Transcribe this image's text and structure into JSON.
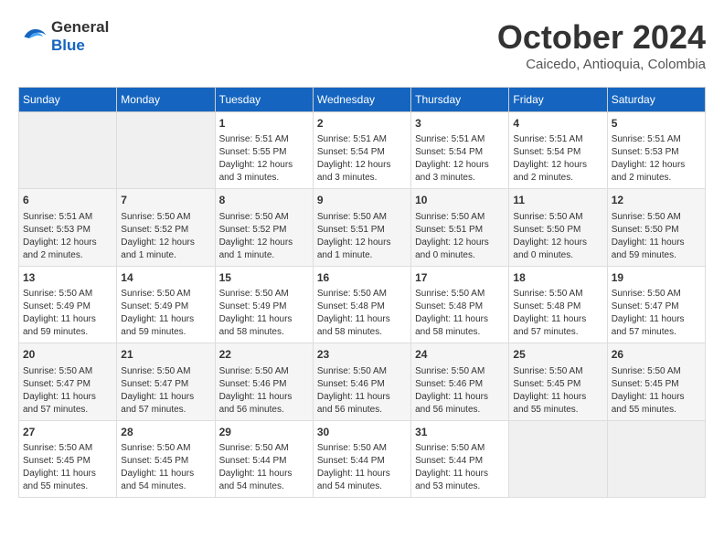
{
  "logo": {
    "line1": "General",
    "line2": "Blue"
  },
  "title": "October 2024",
  "subtitle": "Caicedo, Antioquia, Colombia",
  "weekdays": [
    "Sunday",
    "Monday",
    "Tuesday",
    "Wednesday",
    "Thursday",
    "Friday",
    "Saturday"
  ],
  "weeks": [
    [
      {
        "day": "",
        "info": ""
      },
      {
        "day": "",
        "info": ""
      },
      {
        "day": "1",
        "info": "Sunrise: 5:51 AM\nSunset: 5:55 PM\nDaylight: 12 hours\nand 3 minutes."
      },
      {
        "day": "2",
        "info": "Sunrise: 5:51 AM\nSunset: 5:54 PM\nDaylight: 12 hours\nand 3 minutes."
      },
      {
        "day": "3",
        "info": "Sunrise: 5:51 AM\nSunset: 5:54 PM\nDaylight: 12 hours\nand 3 minutes."
      },
      {
        "day": "4",
        "info": "Sunrise: 5:51 AM\nSunset: 5:54 PM\nDaylight: 12 hours\nand 2 minutes."
      },
      {
        "day": "5",
        "info": "Sunrise: 5:51 AM\nSunset: 5:53 PM\nDaylight: 12 hours\nand 2 minutes."
      }
    ],
    [
      {
        "day": "6",
        "info": "Sunrise: 5:51 AM\nSunset: 5:53 PM\nDaylight: 12 hours\nand 2 minutes."
      },
      {
        "day": "7",
        "info": "Sunrise: 5:50 AM\nSunset: 5:52 PM\nDaylight: 12 hours\nand 1 minute."
      },
      {
        "day": "8",
        "info": "Sunrise: 5:50 AM\nSunset: 5:52 PM\nDaylight: 12 hours\nand 1 minute."
      },
      {
        "day": "9",
        "info": "Sunrise: 5:50 AM\nSunset: 5:51 PM\nDaylight: 12 hours\nand 1 minute."
      },
      {
        "day": "10",
        "info": "Sunrise: 5:50 AM\nSunset: 5:51 PM\nDaylight: 12 hours\nand 0 minutes."
      },
      {
        "day": "11",
        "info": "Sunrise: 5:50 AM\nSunset: 5:50 PM\nDaylight: 12 hours\nand 0 minutes."
      },
      {
        "day": "12",
        "info": "Sunrise: 5:50 AM\nSunset: 5:50 PM\nDaylight: 11 hours\nand 59 minutes."
      }
    ],
    [
      {
        "day": "13",
        "info": "Sunrise: 5:50 AM\nSunset: 5:49 PM\nDaylight: 11 hours\nand 59 minutes."
      },
      {
        "day": "14",
        "info": "Sunrise: 5:50 AM\nSunset: 5:49 PM\nDaylight: 11 hours\nand 59 minutes."
      },
      {
        "day": "15",
        "info": "Sunrise: 5:50 AM\nSunset: 5:49 PM\nDaylight: 11 hours\nand 58 minutes."
      },
      {
        "day": "16",
        "info": "Sunrise: 5:50 AM\nSunset: 5:48 PM\nDaylight: 11 hours\nand 58 minutes."
      },
      {
        "day": "17",
        "info": "Sunrise: 5:50 AM\nSunset: 5:48 PM\nDaylight: 11 hours\nand 58 minutes."
      },
      {
        "day": "18",
        "info": "Sunrise: 5:50 AM\nSunset: 5:48 PM\nDaylight: 11 hours\nand 57 minutes."
      },
      {
        "day": "19",
        "info": "Sunrise: 5:50 AM\nSunset: 5:47 PM\nDaylight: 11 hours\nand 57 minutes."
      }
    ],
    [
      {
        "day": "20",
        "info": "Sunrise: 5:50 AM\nSunset: 5:47 PM\nDaylight: 11 hours\nand 57 minutes."
      },
      {
        "day": "21",
        "info": "Sunrise: 5:50 AM\nSunset: 5:47 PM\nDaylight: 11 hours\nand 57 minutes."
      },
      {
        "day": "22",
        "info": "Sunrise: 5:50 AM\nSunset: 5:46 PM\nDaylight: 11 hours\nand 56 minutes."
      },
      {
        "day": "23",
        "info": "Sunrise: 5:50 AM\nSunset: 5:46 PM\nDaylight: 11 hours\nand 56 minutes."
      },
      {
        "day": "24",
        "info": "Sunrise: 5:50 AM\nSunset: 5:46 PM\nDaylight: 11 hours\nand 56 minutes."
      },
      {
        "day": "25",
        "info": "Sunrise: 5:50 AM\nSunset: 5:45 PM\nDaylight: 11 hours\nand 55 minutes."
      },
      {
        "day": "26",
        "info": "Sunrise: 5:50 AM\nSunset: 5:45 PM\nDaylight: 11 hours\nand 55 minutes."
      }
    ],
    [
      {
        "day": "27",
        "info": "Sunrise: 5:50 AM\nSunset: 5:45 PM\nDaylight: 11 hours\nand 55 minutes."
      },
      {
        "day": "28",
        "info": "Sunrise: 5:50 AM\nSunset: 5:45 PM\nDaylight: 11 hours\nand 54 minutes."
      },
      {
        "day": "29",
        "info": "Sunrise: 5:50 AM\nSunset: 5:44 PM\nDaylight: 11 hours\nand 54 minutes."
      },
      {
        "day": "30",
        "info": "Sunrise: 5:50 AM\nSunset: 5:44 PM\nDaylight: 11 hours\nand 54 minutes."
      },
      {
        "day": "31",
        "info": "Sunrise: 5:50 AM\nSunset: 5:44 PM\nDaylight: 11 hours\nand 53 minutes."
      },
      {
        "day": "",
        "info": ""
      },
      {
        "day": "",
        "info": ""
      }
    ]
  ]
}
